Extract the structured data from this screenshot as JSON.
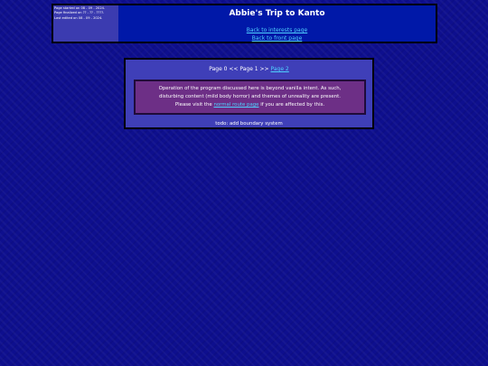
{
  "colors": {
    "background": "#0e0f8e",
    "header_bg": "#0018a8",
    "dates_bg": "#3b3bb0",
    "panel_bg": "#3f3fb8",
    "warning_bg": "#6d2f86",
    "link": "#4fd0ff"
  },
  "header": {
    "started": "Page started on 08 - 09 - 2024.",
    "finalized": "Page finalized on ?? - ?? - ????.",
    "last_edited": "Last edited on 08 - 09 - 2024.",
    "title": "Abbie's Trip to Kanto",
    "links": {
      "interests": "Back to interests page",
      "front": "Back to front page"
    }
  },
  "pager": {
    "prefix": "Page 0 << Page 1 >> ",
    "next_link": "Page 2"
  },
  "warning": {
    "line1": "Operation of the program discussed here is beyond vanilla intent. As such,",
    "line2": "disturbing content (mild body horror) and themes of unreality are present.",
    "line3_before": "Please visit the ",
    "link": "normal route page",
    "line3_after": " if you are affected by this."
  },
  "todo": "todo: add boundary system"
}
